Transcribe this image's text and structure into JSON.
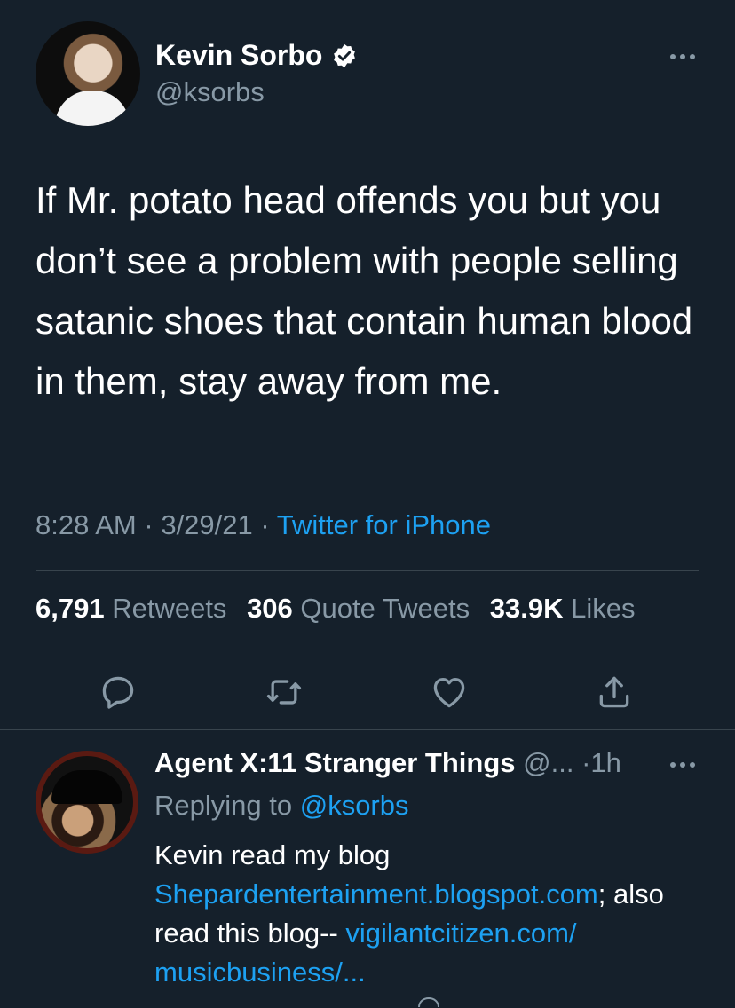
{
  "tweet": {
    "author_name": "Kevin Sorbo",
    "author_handle": "@ksorbs",
    "text": "If Mr. potato head offends you but you don’t see a problem with people selling satanic shoes that contain human blood in them, stay away from me.",
    "time": "8:28 AM",
    "date": "3/29/21",
    "separator": "·",
    "source": "Twitter for iPhone",
    "stats": {
      "retweets_count": "6,791",
      "retweets_label": "Retweets",
      "quotes_count": "306",
      "quotes_label": "Quote Tweets",
      "likes_count": "33.9K",
      "likes_label": "Likes"
    },
    "icons": [
      "verified-badge-icon",
      "more-icon",
      "reply-icon",
      "retweet-icon",
      "like-icon",
      "share-icon"
    ]
  },
  "reply": {
    "author_name": "Agent X:11 Stranger Things",
    "author_handle": "@...",
    "time": "1h",
    "separator": "·",
    "replying_label": "Replying to",
    "replying_to": "@ksorbs",
    "text_part1": "Kevin read my blog",
    "link1": "Shepardentertainment.blogspot.com",
    "text_part2": "; also read this blog-- ",
    "link2": "vigilantcitizen.com/ musicbusiness/..."
  },
  "colors": {
    "background": "#15202b",
    "primary_text": "#ffffff",
    "secondary_text": "#8899a6",
    "accent": "#1da1f2",
    "divider": "#38444d"
  }
}
